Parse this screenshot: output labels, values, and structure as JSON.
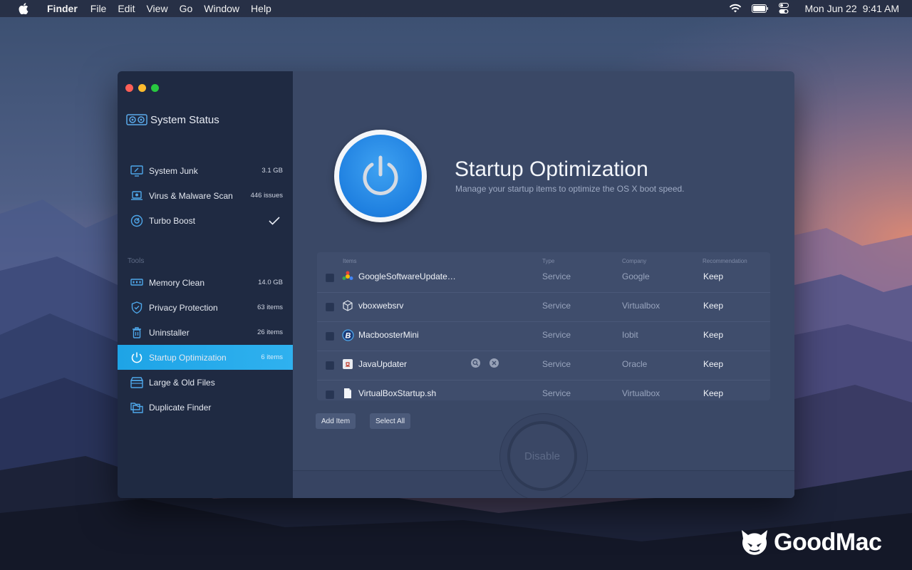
{
  "menubar": {
    "app_name": "Finder",
    "menus": [
      "File",
      "Edit",
      "View",
      "Go",
      "Window",
      "Help"
    ],
    "date": "Mon Jun 22",
    "time": "9:41 AM"
  },
  "window": {
    "traffic_lights": [
      "#ff5f57",
      "#febc2e",
      "#28c840"
    ]
  },
  "sidebar": {
    "header": "System Status",
    "items": [
      {
        "label": "System Junk",
        "value": "3.1 GB",
        "icon": "monitor-broom-icon"
      },
      {
        "label": "Virus & Malware Scan",
        "value": "446 issues",
        "icon": "laptop-shield-icon"
      },
      {
        "label": "Turbo Boost",
        "value": "",
        "icon": "speedometer-icon",
        "status": "checkmark-icon"
      }
    ],
    "tools_label": "Tools",
    "tools": [
      {
        "label": "Memory Clean",
        "value": "14.0 GB",
        "icon": "memory-chip-icon"
      },
      {
        "label": "Privacy Protection",
        "value": "63 items",
        "icon": "shield-check-icon"
      },
      {
        "label": "Uninstaller",
        "value": "26 items",
        "icon": "trash-icon"
      },
      {
        "label": "Startup Optimization",
        "value": "6 items",
        "icon": "power-icon",
        "active": true
      },
      {
        "label": "Large & Old Files",
        "value": "",
        "icon": "box-stack-icon"
      },
      {
        "label": "Duplicate Finder",
        "value": "",
        "icon": "duplicate-folders-icon"
      }
    ]
  },
  "main": {
    "title": "Startup Optimization",
    "subtitle": "Manage your startup items to optimize the OS X boot speed.",
    "table": {
      "columns": [
        "Items",
        "Type",
        "Company",
        "Recommendation"
      ],
      "rows": [
        {
          "name": "GoogleSoftwareUpdate…",
          "type": "Service",
          "company": "Google",
          "recommendation": "Keep",
          "icon": "google-update-icon"
        },
        {
          "name": "vboxwebsrv",
          "type": "Service",
          "company": "Virtualbox",
          "recommendation": "Keep",
          "icon": "virtualbox-cube-icon"
        },
        {
          "name": "MacboosterMini",
          "type": "Service",
          "company": "Iobit",
          "recommendation": "Keep",
          "icon": "macbooster-b-icon"
        },
        {
          "name": "JavaUpdater",
          "type": "Service",
          "company": "Oracle",
          "recommendation": "Keep",
          "icon": "java-icon"
        },
        {
          "name": "VirtualBoxStartup.sh",
          "type": "Service",
          "company": "Virtualbox",
          "recommendation": "Keep",
          "icon": "document-icon"
        }
      ]
    },
    "add_item_label": "Add Item",
    "select_all_label": "Select All",
    "disable_label": "Disable"
  },
  "watermark": {
    "brand": "GoodMac"
  },
  "colors": {
    "accent": "#1ea4e6",
    "sidebar_bg": "#1f2a42",
    "main_bg": "#3a4866"
  }
}
